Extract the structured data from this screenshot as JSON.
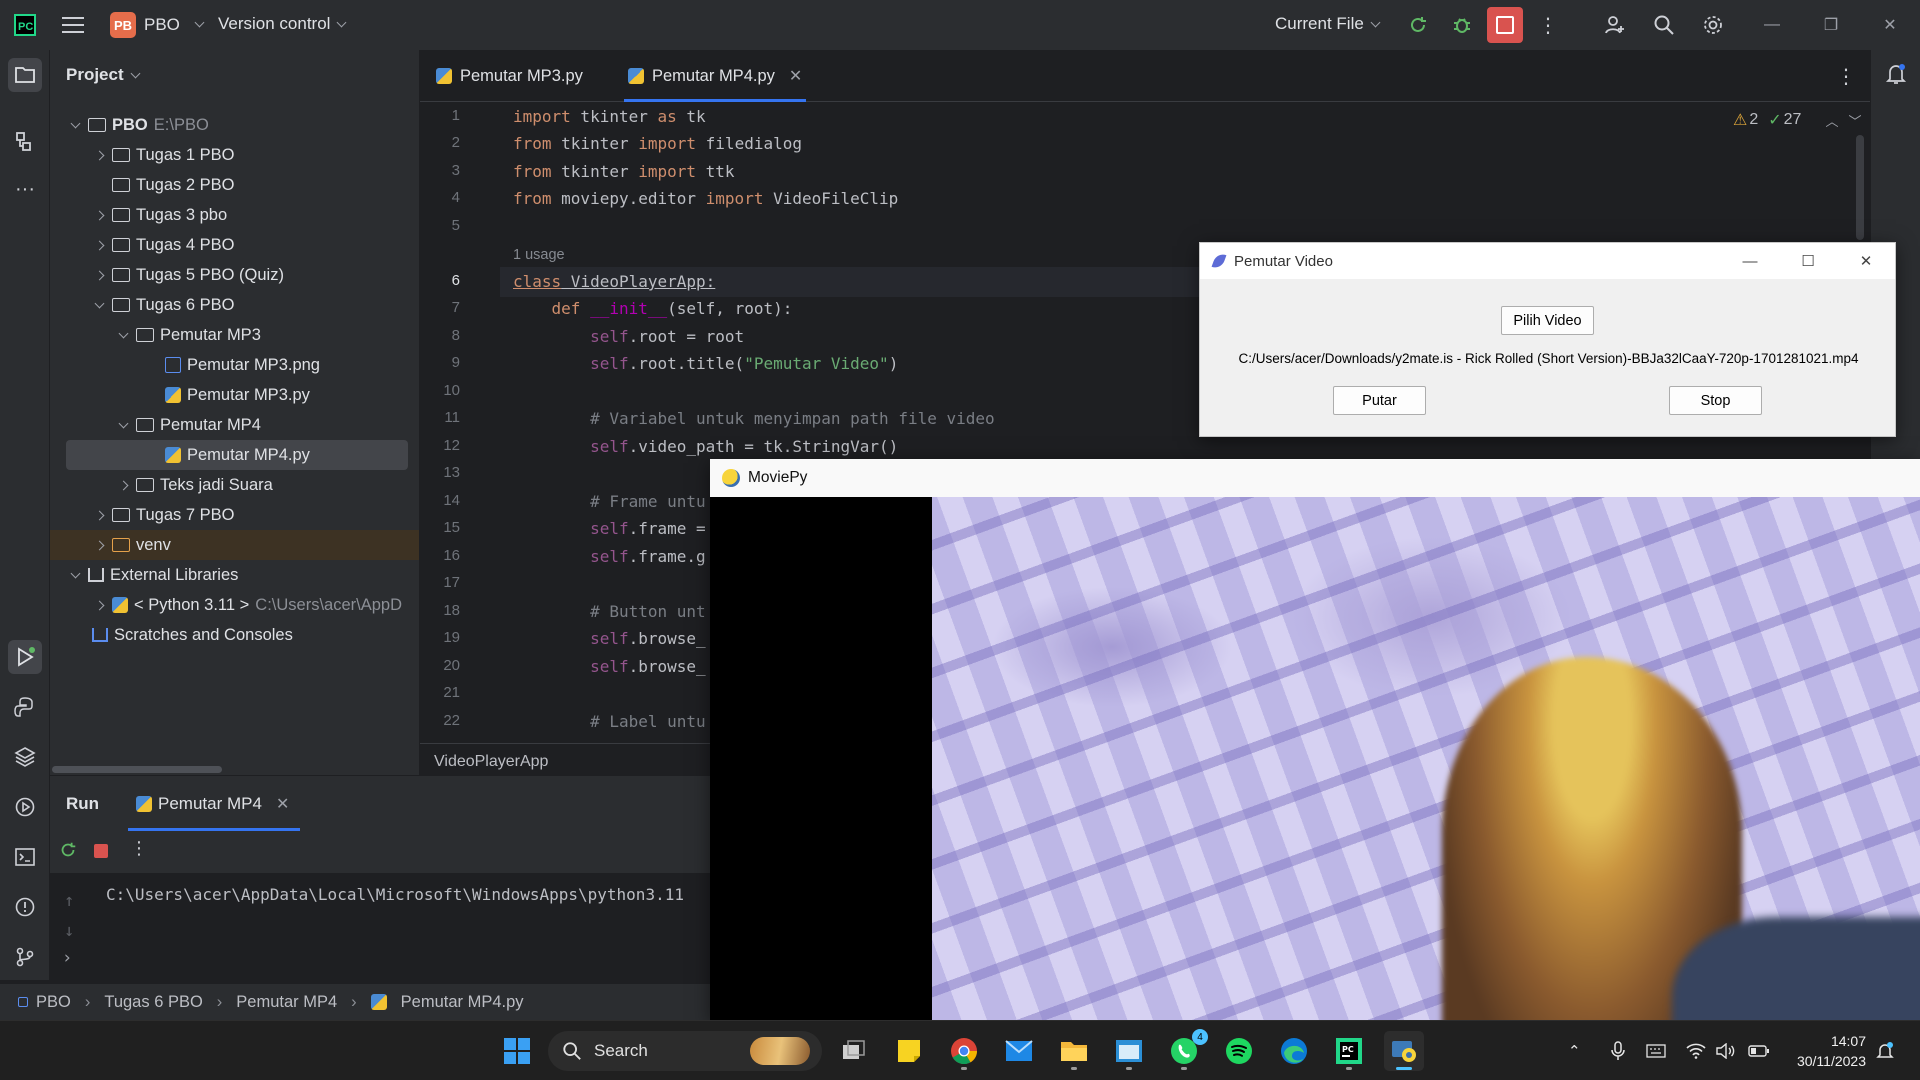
{
  "titlebar": {
    "project_badge": "PB",
    "project_name": "PBO",
    "vcs": "Version control",
    "run_config": "Current File"
  },
  "project_panel": {
    "title": "Project",
    "tree": {
      "root": {
        "label": "PBO",
        "path": "E:\\PBO"
      },
      "items": [
        "Tugas 1 PBO",
        "Tugas 2 PBO",
        "Tugas 3 pbo",
        "Tugas 4 PBO",
        "Tugas 5 PBO (Quiz)",
        "Tugas 6 PBO",
        "Pemutar MP3",
        "Pemutar MP3.png",
        "Pemutar MP3.py",
        "Pemutar MP4",
        "Pemutar MP4.py",
        "Teks jadi Suara",
        "Tugas 7 PBO",
        "venv",
        "External Libraries",
        "< Python 3.11 >",
        "Scratches and Consoles"
      ],
      "python_path": "C:\\Users\\acer\\AppD"
    }
  },
  "editor": {
    "tabs": [
      {
        "label": "Pemutar MP3.py"
      },
      {
        "label": "Pemutar MP4.py"
      }
    ],
    "warnings": "2",
    "ok_count": "27",
    "usage_hint": "1 usage",
    "line_numbers": [
      "1",
      "2",
      "3",
      "4",
      "5",
      "6",
      "7",
      "8",
      "9",
      "10",
      "11",
      "12",
      "13",
      "14",
      "15",
      "16",
      "17",
      "18",
      "19",
      "20",
      "21",
      "22"
    ],
    "breadcrumb": "VideoPlayerApp",
    "code": {
      "l1a": "import",
      "l1b": " tkinter ",
      "l1c": "as",
      "l1d": " tk",
      "l2a": "from",
      "l2b": " tkinter ",
      "l2c": "import",
      "l2d": " filedialog",
      "l3a": "from",
      "l3b": " tkinter ",
      "l3c": "import",
      "l3d": " ttk",
      "l4a": "from",
      "l4b": " moviepy.editor ",
      "l4c": "import",
      "l4d": " VideoFileClip",
      "l6a": "class",
      "l6b": " VideoPlayerApp:",
      "l7a": "def",
      "l7b": " __init__",
      "l7c": "(self, root):",
      "l8a": "self",
      "l8b": ".root = root",
      "l9a": "self",
      "l9b": ".root.title(",
      "l9c": "\"Pemutar Video\"",
      "l9d": ")",
      "l11": "# Variabel untuk menyimpan path file video",
      "l12a": "self",
      "l12b": ".video_path = tk.StringVar()",
      "l14": "# Frame untu",
      "l15a": "self",
      "l15b": ".frame =",
      "l16a": "self",
      "l16b": ".frame.g",
      "l18": "# Button unt",
      "l19a": "self",
      "l19b": ".browse_",
      "l20a": "self",
      "l20b": ".browse_",
      "l22": "# Label untu"
    }
  },
  "run_panel": {
    "title": "Run",
    "tab": "Pemutar MP4",
    "console": "C:\\Users\\acer\\AppData\\Local\\Microsoft\\WindowsApps\\python3.11"
  },
  "status_bar": {
    "crumbs": [
      "PBO",
      "Tugas 6 PBO",
      "Pemutar MP4",
      "Pemutar MP4.py"
    ]
  },
  "tk_window": {
    "title": "Pemutar Video",
    "browse_button": "Pilih Video",
    "path": "C:/Users/acer/Downloads/y2mate.is - Rick Rolled (Short Version)-BBJa32lCaaY-720p-1701281021.mp4",
    "play_button": "Putar",
    "stop_button": "Stop"
  },
  "moviepy_window": {
    "title": "MoviePy"
  },
  "taskbar": {
    "search": "Search",
    "whatsapp_badge": "4",
    "time": "14:07",
    "date": "30/11/2023"
  }
}
